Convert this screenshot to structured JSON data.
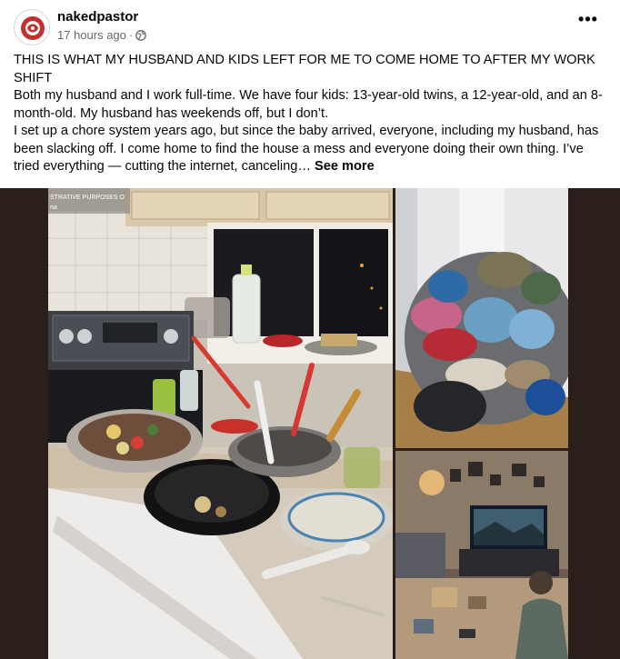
{
  "post": {
    "author": "nakedpastor",
    "time": "17 hours ago",
    "separator": "·",
    "audience_icon": "globe-icon",
    "more_label": "•••",
    "title": "THIS IS WHAT MY HUSBAND AND KIDS LEFT FOR ME TO COME HOME TO AFTER MY WORK SHIFT",
    "para1": "Both my husband and I work full-time. We have four kids: 13-year-old twins, a 12-year-old, and an 8-month-old. My husband has weekends off, but I don’t.",
    "para2": "I set up a chore system years ago, but since the baby arrived, everyone, including my husband, has been slacking off. I come home to find the house a mess and everyone doing their own thing. I’ve tried everything — cutting the internet, canceling…",
    "see_more": "See more"
  },
  "photos": {
    "kitchen_caption": "STRATIVE PURPOSES O",
    "kitchen_caption2": "na"
  },
  "colors": {
    "text": "#050505",
    "secondary": "#65676b",
    "media_bg": "#2a1f1b"
  }
}
